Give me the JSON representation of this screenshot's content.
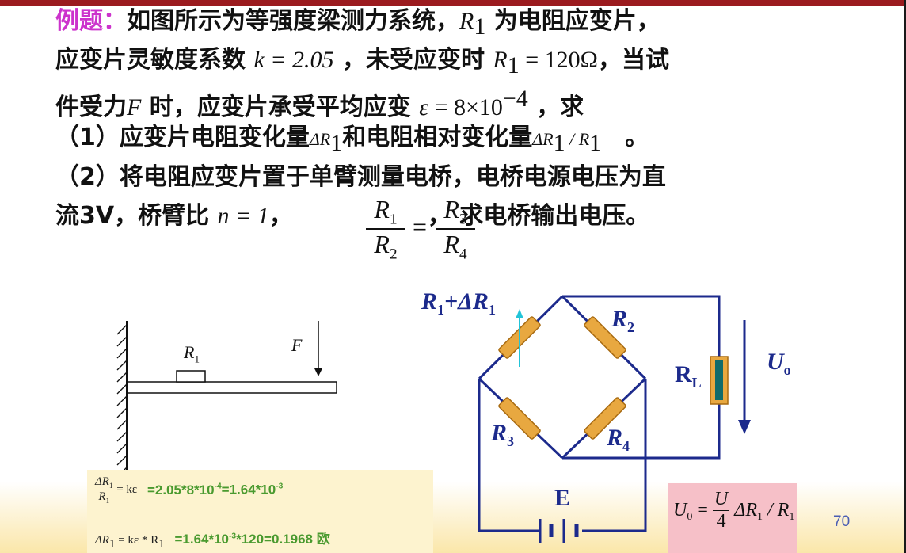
{
  "problem": {
    "heading": "例题：",
    "line1_a": "如图所示为等强度梁测力系统，",
    "line1_sym": "R",
    "line1_sub": "1",
    "line1_b": " 为电阻应变片，",
    "line2_a": "应变片灵敏度系数 ",
    "line2_k": "k = 2.05",
    "line2_b": " ，未受应变时 ",
    "line2_r": "R",
    "line2_rsub": "1",
    "line2_rval": " = 120Ω",
    "line2_c": "，当试",
    "line3_a": "件受力",
    "line3_F": "F",
    "line3_b": " 时，应变片承受平均应变 ",
    "line3_eps": "ε",
    "line3_eq": " = 8×10",
    "line3_exp": "−4",
    "line3_c": " ，求",
    "line4_a": "（1）应变片电阻变化量",
    "line4_sym1": "ΔR",
    "line4_sub1": "1",
    "line4_b": "和电阻相对变化量",
    "line4_sym2": "ΔR",
    "line4_sub2": "1",
    "line4_slash": " / R",
    "line4_sub3": "1",
    "line4_c": "。",
    "line5": "（2）将电阻应变片置于单臂测量电桥，电桥电源电压为直",
    "line6_a": "流3V，桥臂比 ",
    "line6_n": "n = 1",
    "line6_b": "，",
    "line6_c": "，  求电桥输出电压。",
    "frac1_num": "R",
    "frac1_num_sub": "1",
    "frac1_den": "R",
    "frac1_den_sub": "2",
    "frac2_num": "R",
    "frac2_num_sub": "3",
    "frac2_den": "R",
    "frac2_den_sub": "4",
    "frac_eq": "="
  },
  "beam": {
    "r1_label": "R",
    "r1_sub": "1",
    "force_label": "F"
  },
  "bridge": {
    "r1_label": "R",
    "r1_sub": "1",
    "r1_plus": "+ΔR",
    "r1_plus_sub": "1",
    "r2_label": "R",
    "r2_sub": "2",
    "r3_label": "R",
    "r3_sub": "3",
    "r4_label": "R",
    "r4_sub": "4",
    "rl_label": "R",
    "rl_sub": "L",
    "uo_label": "U",
    "uo_sub": "o",
    "e_label": "E"
  },
  "solution": {
    "f1_num": "ΔR",
    "f1_num_sub": "1",
    "f1_den": "R",
    "f1_den_sub": "1",
    "f1_rhs": "= kε",
    "f1_calc": "=2.05*8*10",
    "f1_exp1": "-4",
    "f1_calc2": "=1.64*10",
    "f1_exp2": "-3",
    "f2_lhs": "ΔR",
    "f2_lhs_sub": "1",
    "f2_mid": " = kε * R",
    "f2_mid_sub": "1",
    "f2_calc": "=1.64*10",
    "f2_exp": "-3",
    "f2_calc2": "*120=0.1968 欧",
    "u0_lhs": "U",
    "u0_lhs_sub": "0",
    "u0_eq": " = ",
    "u0_num": "U",
    "u0_den": "4",
    "u0_rhs": "ΔR",
    "u0_rhs_sub": "1",
    "u0_rhs2": " / R",
    "u0_rhs2_sub": "1"
  },
  "page_number": "70",
  "colors": {
    "heading": "#cc33cc",
    "circuit": "#1c2a8c",
    "resistor_fill": "#e8a840",
    "formula_green": "#4a9a2f",
    "accent_bar": "#9b1b1f"
  }
}
